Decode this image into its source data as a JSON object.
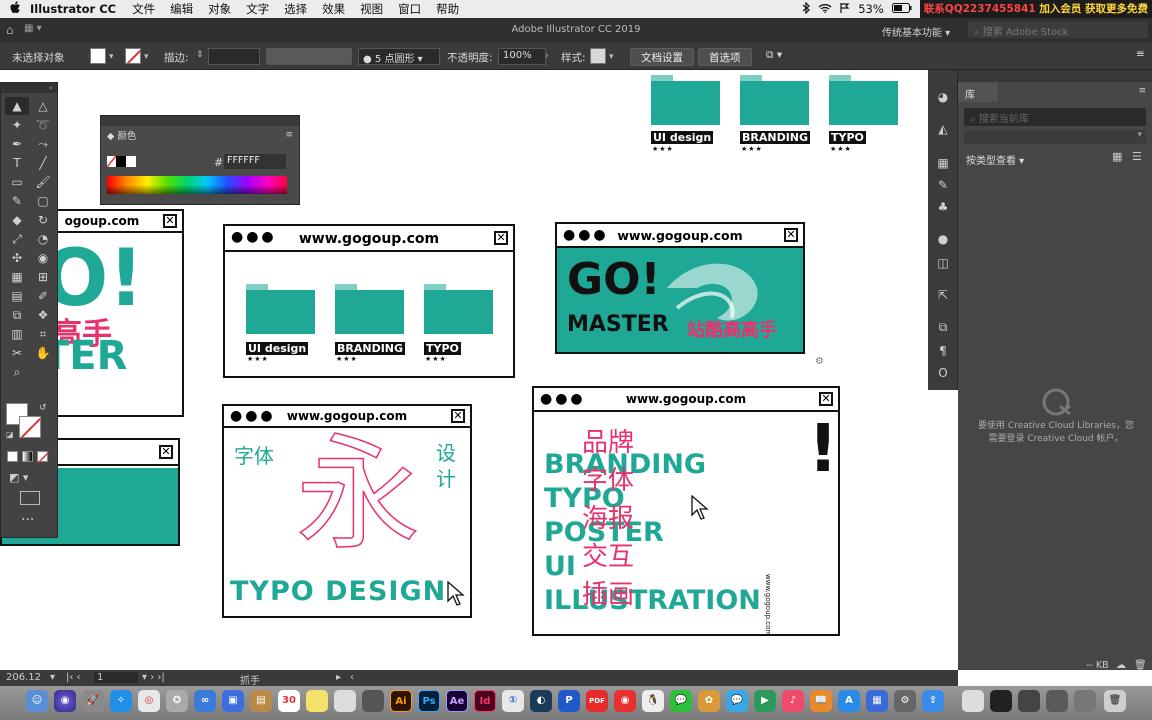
{
  "menubar": {
    "apple": "",
    "app": "Illustrator CC",
    "items": [
      "文件",
      "编辑",
      "对象",
      "文字",
      "选择",
      "效果",
      "视图",
      "窗口",
      "帮助"
    ],
    "battery": "53%",
    "promo_a": "联系QQ2237455841",
    "promo_b": "加入会员 获取更多免费"
  },
  "titlebar": {
    "title": "Adobe Illustrator CC 2019",
    "workspace": "传统基本功能",
    "search_placeholder": "搜索 Adobe Stock"
  },
  "controlbar": {
    "selection": "未选择对象",
    "stroke_label": "描边:",
    "brush": "5 点圆形",
    "opacity_label": "不透明度:",
    "opacity": "100%",
    "style_label": "样式:",
    "doc_settings": "文档设置",
    "preferences": "首选项"
  },
  "color_panel": {
    "title": "颜色",
    "hash": "#",
    "hex": "FFFFFF"
  },
  "canvas": {
    "url": "www.gogoup.com",
    "url_partial": "ogoup.com",
    "folders": [
      "UI design",
      "BRANDING",
      "TYPO"
    ],
    "stars": "★★★",
    "hero_go": "GO!",
    "hero_master": "MASTER",
    "hero_cn": "站酷高高手",
    "left_go": "O!",
    "left_cn": "高手",
    "left_ster": "TER",
    "typo_ziti": "字体",
    "typo_sheji": "设计",
    "typo_yong": "永",
    "typo_design": "TYPO DESIGN",
    "brand_en": [
      "BRANDING",
      "TYPO",
      "POSTER",
      "UI",
      "ILLUSTRATION"
    ],
    "brand_cn": [
      "品牌",
      "字体",
      "海报",
      "交互",
      "插画"
    ],
    "brand_exclaim": "!",
    "brand_vertical": "www.gogoup.com"
  },
  "library": {
    "tab": "库",
    "search_placeholder": "搜索当前库",
    "view_label": "按类型查看",
    "message": "要使用 Creative Cloud Libraries，您需要登录 Creative Cloud 帐户。",
    "kb": "-- KB"
  },
  "statusbar": {
    "zoom": "206.12",
    "artboard": "1",
    "tool": "抓手"
  },
  "dock": {
    "ai": "Ai",
    "ps": "Ps",
    "ae": "Ae",
    "id": "Id",
    "pdf": "PDF",
    "cal": "30",
    "p": "P"
  },
  "colors": {
    "teal": "#1fa896",
    "pink": "#e8326e",
    "ui_dark": "#3a3a3a"
  }
}
